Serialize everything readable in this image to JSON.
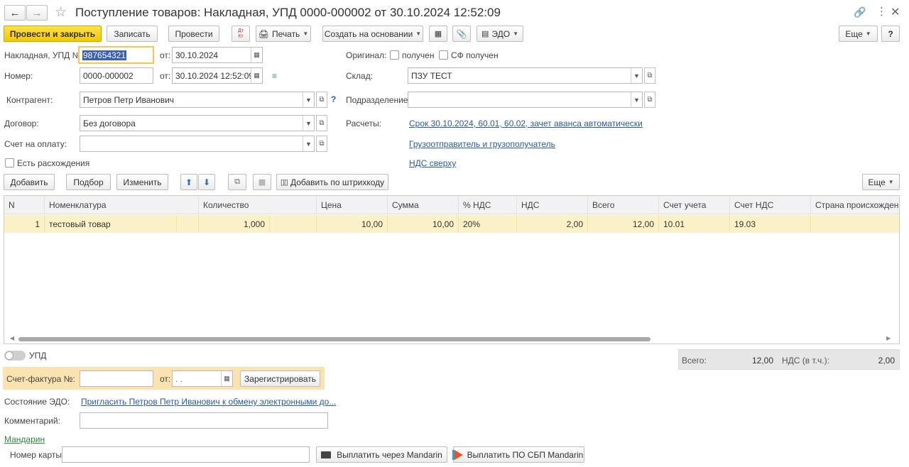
{
  "title": "Поступление товаров: Накладная, УПД 0000-000002 от 30.10.2024 12:52:09",
  "toolbar": {
    "post_close": "Провести и закрыть",
    "save": "Записать",
    "post": "Провести",
    "dt_kt": "Дт Кт",
    "print": "Печать",
    "create_based": "Создать на основании",
    "edo": "ЭДО",
    "more": "Еще",
    "help": "?"
  },
  "form": {
    "invoice_label": "Накладная, УПД №:",
    "invoice_number": "987654321",
    "from_label": "от:",
    "invoice_date": "30.10.2024",
    "original_label": "Оригинал:",
    "received": "получен",
    "sf_received": "СФ получен",
    "number_label": "Номер:",
    "number": "0000-000002",
    "number_from_label": "от:",
    "number_date": "30.10.2024 12:52:09",
    "warehouse_label": "Склад:",
    "warehouse": "ПЗУ ТЕСТ",
    "counterparty_label": "Контрагент:",
    "counterparty": "Петров Петр Иванович",
    "division_label": "Подразделение:",
    "division": "",
    "contract_label": "Договор:",
    "contract": "Без договора",
    "settlements_label": "Расчеты:",
    "settlements_link": "Срок 30.10.2024, 60.01, 60.02, зачет аванса автоматически",
    "payment_invoice_label": "Счет на оплату:",
    "payment_invoice": "",
    "shipper_link": "Грузоотправитель и грузополучатель",
    "discrepancies": "Есть расхождения",
    "vat_link": "НДС сверху"
  },
  "table_toolbar": {
    "add": "Добавить",
    "pick": "Подбор",
    "edit": "Изменить",
    "barcode": "Добавить по штрихкоду",
    "more": "Еще"
  },
  "table": {
    "columns": [
      "N",
      "Номенклатура",
      "Количество",
      "Цена",
      "Сумма",
      "% НДС",
      "НДС",
      "Всего",
      "Счет учета",
      "Счет НДС",
      "Страна происхождения"
    ],
    "rows": [
      [
        "1",
        "тестовый товар",
        "1,000",
        "10,00",
        "10,00",
        "20%",
        "2,00",
        "12,00",
        "10.01",
        "19.03",
        ""
      ]
    ]
  },
  "bottom": {
    "upd_label": "УПД",
    "total_label": "Всего:",
    "total": "12,00",
    "vat_label": "НДС (в т.ч.):",
    "vat": "2,00",
    "sf_label": "Счет-фактура №:",
    "sf_number": "",
    "sf_from_label": "от:",
    "sf_date": " .  .",
    "register": "Зарегистрировать",
    "edo_state_label": "Состояние ЭДО:",
    "edo_state_link": "Пригласить Петров Петр Иванович к обмену электронными до...",
    "comment_label": "Комментарий:",
    "comment": "",
    "mandarin_link": "Мандарин",
    "card_label": "Номер карты:",
    "card": "",
    "pay_mandarin": "Выплатить через Mandarin",
    "pay_sbp": "Выплатить ПО СБП Mandarin"
  }
}
